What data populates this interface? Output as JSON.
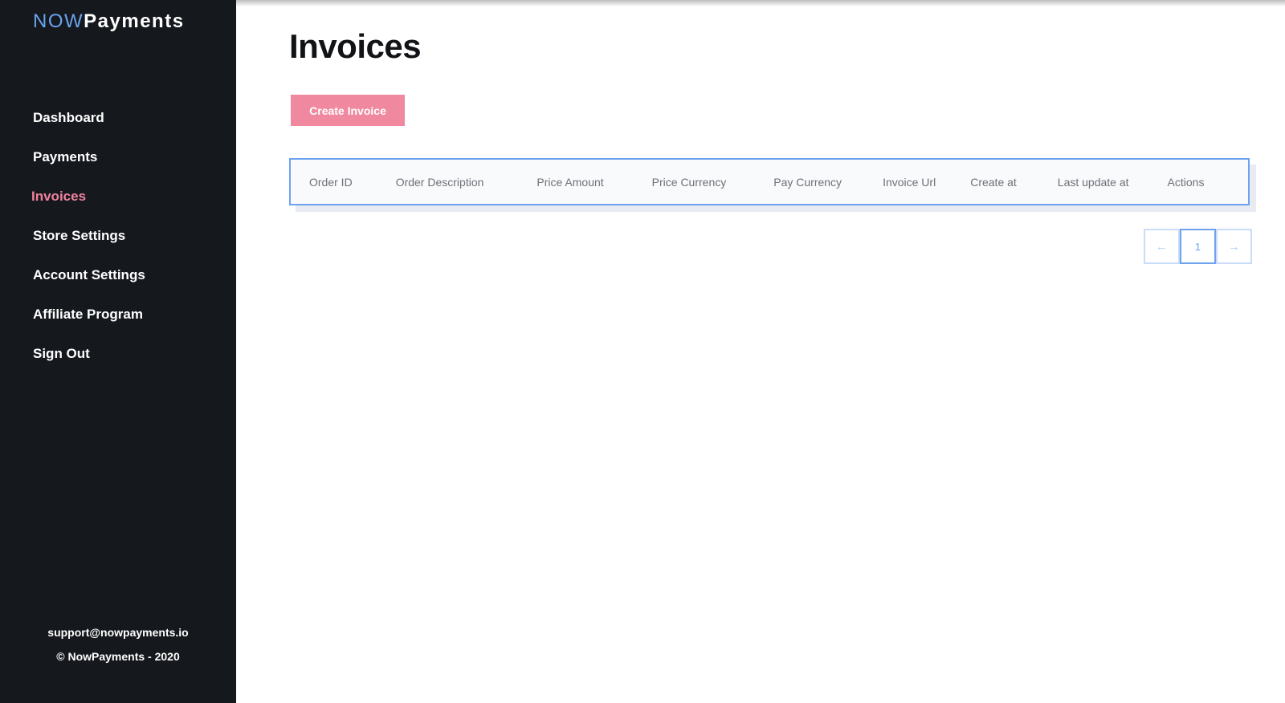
{
  "brand": {
    "part1": "NOW",
    "part2": "Payments"
  },
  "sidebar": {
    "items": [
      {
        "label": "Dashboard",
        "active": false
      },
      {
        "label": "Payments",
        "active": false
      },
      {
        "label": "Invoices",
        "active": true
      },
      {
        "label": "Store Settings",
        "active": false
      },
      {
        "label": "Account Settings",
        "active": false
      },
      {
        "label": "Affiliate Program",
        "active": false
      },
      {
        "label": "Sign Out",
        "active": false
      }
    ],
    "footer": {
      "email": "support@nowpayments.io",
      "copyright": "© NowPayments - 2020"
    }
  },
  "main": {
    "title": "Invoices",
    "create_button": "Create Invoice",
    "table": {
      "columns": [
        "Order ID",
        "Order Description",
        "Price Amount",
        "Price Currency",
        "Pay Currency",
        "Invoice Url",
        "Create at",
        "Last update at",
        "Actions"
      ],
      "rows": []
    },
    "pagination": {
      "prev": "←",
      "current": "1",
      "next": "→"
    }
  },
  "colors": {
    "sidebar_bg": "#15181d",
    "accent_pink": "#f0829e",
    "accent_blue": "#6da2ee"
  }
}
